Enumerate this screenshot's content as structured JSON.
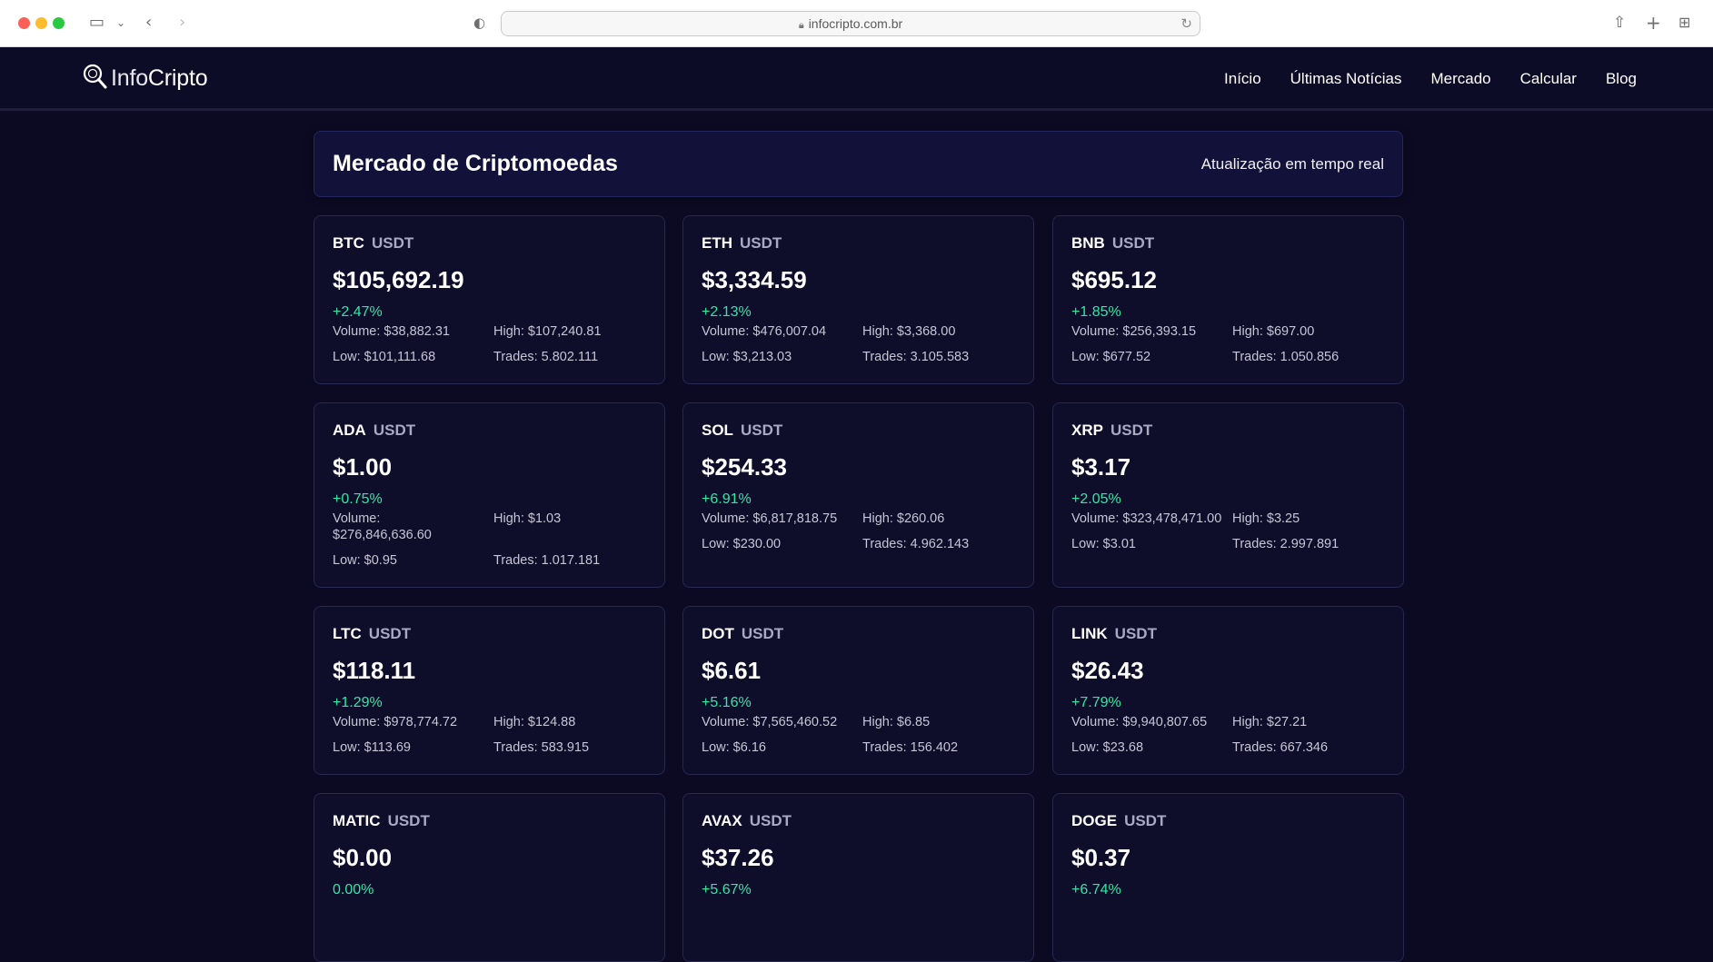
{
  "browser": {
    "url": "infocripto.com.br"
  },
  "header": {
    "logo_light": "Info",
    "logo_bold": "Cripto",
    "nav": [
      "Início",
      "Últimas Notícias",
      "Mercado",
      "Calcular",
      "Blog"
    ]
  },
  "main": {
    "title": "Mercado de Criptomoedas",
    "realtime": "Atualização em tempo real"
  },
  "cards": [
    {
      "symbol": "BTC",
      "quote": "USDT",
      "price": "$105,692.19",
      "change": "+2.47%",
      "volume": "Volume: $38,882.31",
      "high": "High: $107,240.81",
      "low": "Low: $101,111.68",
      "trades": "Trades: 5.802.111"
    },
    {
      "symbol": "ETH",
      "quote": "USDT",
      "price": "$3,334.59",
      "change": "+2.13%",
      "volume": "Volume: $476,007.04",
      "high": "High: $3,368.00",
      "low": "Low: $3,213.03",
      "trades": "Trades: 3.105.583"
    },
    {
      "symbol": "BNB",
      "quote": "USDT",
      "price": "$695.12",
      "change": "+1.85%",
      "volume": "Volume: $256,393.15",
      "high": "High: $697.00",
      "low": "Low: $677.52",
      "trades": "Trades: 1.050.856"
    },
    {
      "symbol": "ADA",
      "quote": "USDT",
      "price": "$1.00",
      "change": "+0.75%",
      "volume": "Volume: $276,846,636.60",
      "high": "High: $1.03",
      "low": "Low: $0.95",
      "trades": "Trades: 1.017.181"
    },
    {
      "symbol": "SOL",
      "quote": "USDT",
      "price": "$254.33",
      "change": "+6.91%",
      "volume": "Volume: $6,817,818.75",
      "high": "High: $260.06",
      "low": "Low: $230.00",
      "trades": "Trades: 4.962.143"
    },
    {
      "symbol": "XRP",
      "quote": "USDT",
      "price": "$3.17",
      "change": "+2.05%",
      "volume": "Volume: $323,478,471.00",
      "high": "High: $3.25",
      "low": "Low: $3.01",
      "trades": "Trades: 2.997.891"
    },
    {
      "symbol": "LTC",
      "quote": "USDT",
      "price": "$118.11",
      "change": "+1.29%",
      "volume": "Volume: $978,774.72",
      "high": "High: $124.88",
      "low": "Low: $113.69",
      "trades": "Trades: 583.915"
    },
    {
      "symbol": "DOT",
      "quote": "USDT",
      "price": "$6.61",
      "change": "+5.16%",
      "volume": "Volume: $7,565,460.52",
      "high": "High: $6.85",
      "low": "Low: $6.16",
      "trades": "Trades: 156.402"
    },
    {
      "symbol": "LINK",
      "quote": "USDT",
      "price": "$26.43",
      "change": "+7.79%",
      "volume": "Volume: $9,940,807.65",
      "high": "High: $27.21",
      "low": "Low: $23.68",
      "trades": "Trades: 667.346"
    },
    {
      "symbol": "MATIC",
      "quote": "USDT",
      "price": "$0.00",
      "change": "0.00%"
    },
    {
      "symbol": "AVAX",
      "quote": "USDT",
      "price": "$37.26",
      "change": "+5.67%"
    },
    {
      "symbol": "DOGE",
      "quote": "USDT",
      "price": "$0.37",
      "change": "+6.74%"
    }
  ],
  "colors": {
    "background": "#0b0a22",
    "card": "#0e0d2a",
    "positive": "#2ee8a8"
  }
}
